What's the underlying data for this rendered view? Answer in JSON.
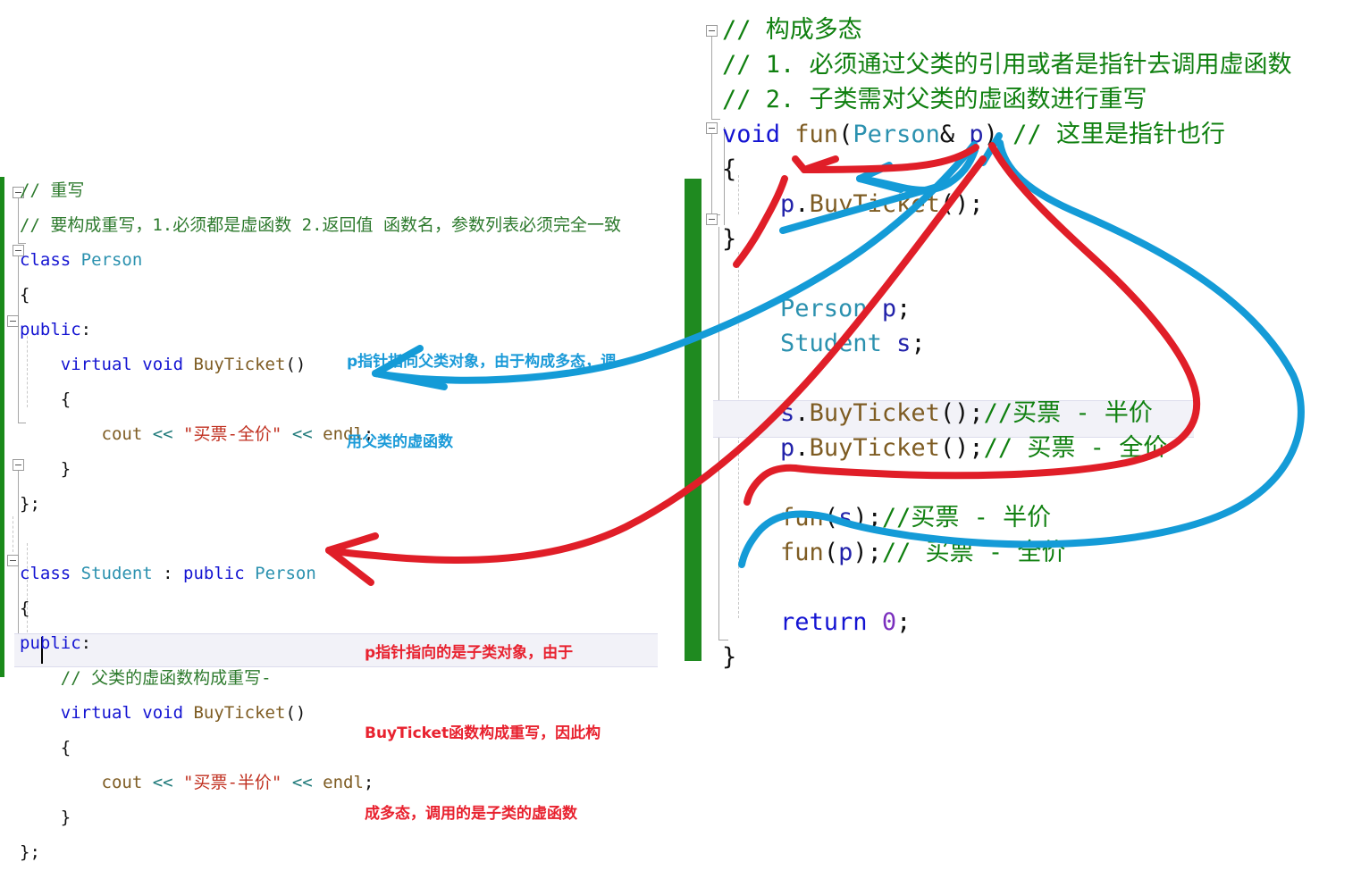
{
  "left_editor": {
    "lines": [
      {
        "id": "l1",
        "indent": 0,
        "tokens": [
          {
            "t": "// 重写",
            "c": "cmt2"
          }
        ]
      },
      {
        "id": "l2",
        "indent": 0,
        "tokens": [
          {
            "t": "// 要构成重写，1.必须都是虚函数 2.返回值 函数名，参数列表必须完全一致",
            "c": "cmt2"
          }
        ]
      },
      {
        "id": "l3",
        "indent": 0,
        "tokens": [
          {
            "t": "class ",
            "c": "kw"
          },
          {
            "t": "Person",
            "c": "type"
          }
        ]
      },
      {
        "id": "l4",
        "indent": 0,
        "tokens": [
          {
            "t": "{",
            "c": "pun"
          }
        ]
      },
      {
        "id": "l5",
        "indent": 0,
        "tokens": [
          {
            "t": "public",
            "c": "kw"
          },
          {
            "t": ":",
            "c": "pun"
          }
        ]
      },
      {
        "id": "l6",
        "indent": 2,
        "tokens": [
          {
            "t": "virtual void ",
            "c": "kw"
          },
          {
            "t": "BuyTicket",
            "c": "fn"
          },
          {
            "t": "()",
            "c": "pun"
          }
        ]
      },
      {
        "id": "l7",
        "indent": 2,
        "tokens": [
          {
            "t": "{",
            "c": "pun"
          }
        ]
      },
      {
        "id": "l8",
        "indent": 4,
        "tokens": [
          {
            "t": "cout ",
            "c": "fn"
          },
          {
            "t": "<< ",
            "c": "op"
          },
          {
            "t": "\"买票-全价\"",
            "c": "str"
          },
          {
            "t": " << ",
            "c": "op"
          },
          {
            "t": "endl",
            "c": "fn"
          },
          {
            "t": ";",
            "c": "pun"
          }
        ]
      },
      {
        "id": "l9",
        "indent": 2,
        "tokens": [
          {
            "t": "}",
            "c": "pun"
          }
        ]
      },
      {
        "id": "l10",
        "indent": 0,
        "tokens": [
          {
            "t": "};",
            "c": "pun"
          }
        ]
      },
      {
        "id": "l11",
        "indent": 0,
        "tokens": [
          {
            "t": "",
            "c": "pun"
          }
        ]
      },
      {
        "id": "l12",
        "indent": 0,
        "tokens": [
          {
            "t": "class ",
            "c": "kw"
          },
          {
            "t": "Student",
            "c": "type"
          },
          {
            "t": " : ",
            "c": "pun"
          },
          {
            "t": "public ",
            "c": "kw"
          },
          {
            "t": "Person",
            "c": "type"
          }
        ]
      },
      {
        "id": "l13",
        "indent": 0,
        "tokens": [
          {
            "t": "{",
            "c": "pun"
          }
        ]
      },
      {
        "id": "l14",
        "indent": 0,
        "tokens": [
          {
            "t": "public",
            "c": "kw"
          },
          {
            "t": ":",
            "c": "pun"
          }
        ]
      },
      {
        "id": "l15",
        "indent": 2,
        "tokens": [
          {
            "t": "// 父类的虚函数构成重写-",
            "c": "cmt2"
          }
        ]
      },
      {
        "id": "l16",
        "indent": 2,
        "tokens": [
          {
            "t": "virtual void ",
            "c": "kw"
          },
          {
            "t": "BuyTicket",
            "c": "fn"
          },
          {
            "t": "()",
            "c": "pun"
          }
        ]
      },
      {
        "id": "l17",
        "indent": 2,
        "tokens": [
          {
            "t": "{",
            "c": "pun"
          }
        ]
      },
      {
        "id": "l18",
        "indent": 4,
        "tokens": [
          {
            "t": "cout ",
            "c": "fn"
          },
          {
            "t": "<< ",
            "c": "op"
          },
          {
            "t": "\"买票-半价\"",
            "c": "str"
          },
          {
            "t": " << ",
            "c": "op"
          },
          {
            "t": "endl",
            "c": "fn"
          },
          {
            "t": ";",
            "c": "pun"
          }
        ]
      },
      {
        "id": "l19",
        "indent": 2,
        "tokens": [
          {
            "t": "}",
            "c": "pun"
          }
        ]
      },
      {
        "id": "l20",
        "indent": 0,
        "tokens": [
          {
            "t": "};",
            "c": "pun"
          }
        ]
      }
    ]
  },
  "right_editor": {
    "lines": [
      {
        "id": "r1",
        "indent": 0,
        "tokens": [
          {
            "t": "// 构成多态",
            "c": "cmt"
          }
        ]
      },
      {
        "id": "r2",
        "indent": 0,
        "tokens": [
          {
            "t": "// 1. 必须通过父类的引用或者是指针去调用虚函数",
            "c": "cmt"
          }
        ]
      },
      {
        "id": "r3",
        "indent": 0,
        "tokens": [
          {
            "t": "// 2. 子类需对父类的虚函数进行重写",
            "c": "cmt"
          }
        ]
      },
      {
        "id": "r4",
        "indent": 0,
        "tokens": [
          {
            "t": "void ",
            "c": "kw"
          },
          {
            "t": "fun",
            "c": "fn"
          },
          {
            "t": "(",
            "c": "pun"
          },
          {
            "t": "Person",
            "c": "type"
          },
          {
            "t": "& ",
            "c": "pun"
          },
          {
            "t": "p",
            "c": "var"
          },
          {
            "t": ") ",
            "c": "pun"
          },
          {
            "t": "// 这里是指针也行",
            "c": "cmt"
          }
        ]
      },
      {
        "id": "r5",
        "indent": 0,
        "tokens": [
          {
            "t": "{",
            "c": "pun"
          }
        ]
      },
      {
        "id": "r6",
        "indent": 2,
        "tokens": [
          {
            "t": "p",
            "c": "var"
          },
          {
            "t": ".",
            "c": "pun"
          },
          {
            "t": "BuyTicket",
            "c": "fn"
          },
          {
            "t": "();",
            "c": "pun"
          }
        ]
      },
      {
        "id": "r7",
        "indent": 0,
        "tokens": [
          {
            "t": "}",
            "c": "pun"
          }
        ]
      },
      {
        "id": "r8",
        "indent": 0,
        "tokens": [
          {
            "t": "",
            "c": "pun"
          }
        ]
      },
      {
        "id": "r9",
        "indent": 2,
        "tokens": [
          {
            "t": "Person ",
            "c": "type"
          },
          {
            "t": "p",
            "c": "var"
          },
          {
            "t": ";",
            "c": "pun"
          }
        ]
      },
      {
        "id": "r10",
        "indent": 2,
        "tokens": [
          {
            "t": "Student ",
            "c": "type"
          },
          {
            "t": "s",
            "c": "var"
          },
          {
            "t": ";",
            "c": "pun"
          }
        ]
      },
      {
        "id": "r11",
        "indent": 0,
        "tokens": [
          {
            "t": "",
            "c": "pun"
          }
        ]
      },
      {
        "id": "r12",
        "indent": 2,
        "tokens": [
          {
            "t": "s",
            "c": "var"
          },
          {
            "t": ".",
            "c": "pun"
          },
          {
            "t": "BuyTicket",
            "c": "fn"
          },
          {
            "t": "();",
            "c": "pun"
          },
          {
            "t": "//买票 - 半价",
            "c": "cmt"
          }
        ]
      },
      {
        "id": "r13",
        "indent": 2,
        "tokens": [
          {
            "t": "p",
            "c": "var"
          },
          {
            "t": ".",
            "c": "pun"
          },
          {
            "t": "BuyTicket",
            "c": "fn"
          },
          {
            "t": "();",
            "c": "pun"
          },
          {
            "t": "// 买票 - 全价",
            "c": "cmt"
          }
        ]
      },
      {
        "id": "r14",
        "indent": 0,
        "tokens": [
          {
            "t": "",
            "c": "pun"
          }
        ]
      },
      {
        "id": "r15",
        "indent": 2,
        "tokens": [
          {
            "t": "fun",
            "c": "fn"
          },
          {
            "t": "(",
            "c": "pun"
          },
          {
            "t": "s",
            "c": "var"
          },
          {
            "t": ");",
            "c": "pun"
          },
          {
            "t": "//买票 - 半价",
            "c": "cmt"
          }
        ]
      },
      {
        "id": "r16",
        "indent": 2,
        "tokens": [
          {
            "t": "fun",
            "c": "fn"
          },
          {
            "t": "(",
            "c": "pun"
          },
          {
            "t": "p",
            "c": "var"
          },
          {
            "t": ");",
            "c": "pun"
          },
          {
            "t": "// 买票 - 全价",
            "c": "cmt"
          }
        ]
      },
      {
        "id": "r17",
        "indent": 0,
        "tokens": [
          {
            "t": "",
            "c": "pun"
          }
        ]
      },
      {
        "id": "r18",
        "indent": 2,
        "tokens": [
          {
            "t": "return ",
            "c": "kw"
          },
          {
            "t": "0",
            "c": "num"
          },
          {
            "t": ";",
            "c": "pun"
          }
        ]
      },
      {
        "id": "r19",
        "indent": 0,
        "tokens": [
          {
            "t": "}",
            "c": "pun"
          }
        ]
      }
    ]
  },
  "annotations": {
    "blue_note": {
      "line1": "p指针指向父类对象，由于构成多态，调",
      "line2": "用父类的虚函数",
      "color": "#1a9ad8"
    },
    "red_note": {
      "line1": "p指针指向的是子类对象，由于",
      "line2": "BuyTicket函数构成重写，因此构",
      "line3": "成多态，调用的是子类的虚函数",
      "color": "#e8222f"
    }
  },
  "colors": {
    "divider_green": "#1f8a20",
    "keyword_blue": "#1414d2",
    "type_teal": "#2b91af",
    "function_brown": "#7e5c23",
    "string_red": "#c03020",
    "comment_green": "#108010",
    "annotation_blue": "#1a9ad8",
    "annotation_red": "#e8222f",
    "current_line_bg": "#f2f2f8"
  }
}
